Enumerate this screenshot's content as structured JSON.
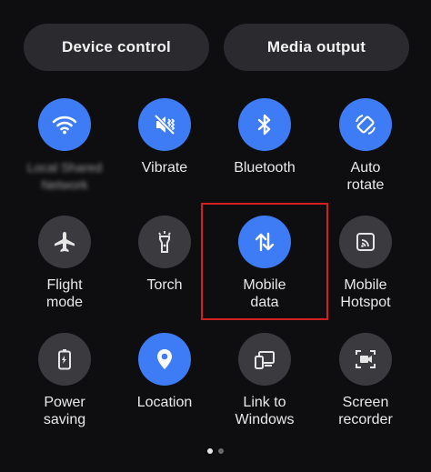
{
  "top_buttons": {
    "device_control": "Device control",
    "media_output": "Media output"
  },
  "tiles": [
    {
      "label": "Local Shared\nNetwork",
      "icon": "wifi-icon",
      "state": "on",
      "blurred": true
    },
    {
      "label": "Vibrate",
      "icon": "vibrate-icon",
      "state": "on"
    },
    {
      "label": "Bluetooth",
      "icon": "bluetooth-icon",
      "state": "on"
    },
    {
      "label": "Auto\nrotate",
      "icon": "auto-rotate-icon",
      "state": "on"
    },
    {
      "label": "Flight\nmode",
      "icon": "airplane-icon",
      "state": "off"
    },
    {
      "label": "Torch",
      "icon": "flashlight-icon",
      "state": "off"
    },
    {
      "label": "Mobile\ndata",
      "icon": "mobile-data-icon",
      "state": "on"
    },
    {
      "label": "Mobile\nHotspot",
      "icon": "hotspot-icon",
      "state": "off"
    },
    {
      "label": "Power\nsaving",
      "icon": "battery-saver-icon",
      "state": "off"
    },
    {
      "label": "Location",
      "icon": "location-icon",
      "state": "on"
    },
    {
      "label": "Link to\nWindows",
      "icon": "link-to-windows-icon",
      "state": "off"
    },
    {
      "label": "Screen\nrecorder",
      "icon": "screen-recorder-icon",
      "state": "off"
    }
  ],
  "pager": {
    "pages": 2,
    "current": 1
  },
  "colors": {
    "accent": "#3d7cf5",
    "tile_off": "#3b3b3f",
    "highlight": "#d21f1f"
  }
}
